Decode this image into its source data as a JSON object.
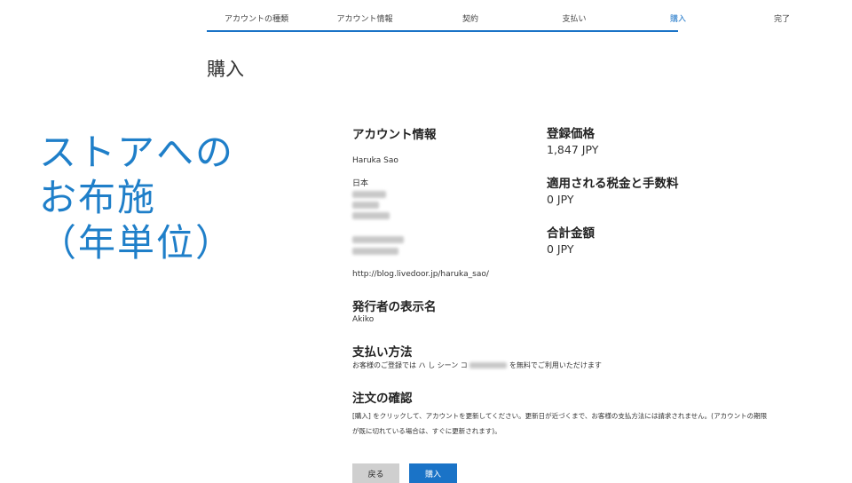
{
  "steps": [
    {
      "label": "アカウントの種類",
      "active": false
    },
    {
      "label": "アカウント情報",
      "active": false
    },
    {
      "label": "契約",
      "active": false
    },
    {
      "label": "支払い",
      "active": false
    },
    {
      "label": "購入",
      "active": true
    },
    {
      "label": "完了",
      "active": false
    }
  ],
  "page_title": "購入",
  "overlay": {
    "line1": "ストアへの",
    "line2": "お布施",
    "line3": "（年単位）",
    "color": "#1f7fc9"
  },
  "account": {
    "heading": "アカウント情報",
    "name": "Haruka Sao",
    "country": "日本",
    "url": "http://blog.livedoor.jp/haruka_sao/"
  },
  "publisher": {
    "heading": "発行者の表示名",
    "value": "Akiko"
  },
  "payment": {
    "heading": "支払い方法",
    "text_a": "お客様のご登録では ハ し シーン コ",
    "text_b": "を無料でご利用いただけます"
  },
  "confirm": {
    "heading": "注文の確認",
    "line1": "[購入] をクリックして、アカウントを更新してください。更新日が近づくまで、お客様の支払方法には請求されません。(アカウントの期限",
    "line2": "が既に切れている場合は、すぐに更新されます)。"
  },
  "pricing": {
    "registration_label": "登録価格",
    "registration_value": "1,847 JPY",
    "tax_label": "適用される税金と手数料",
    "tax_value": "0 JPY",
    "total_label": "合計金額",
    "total_value": "0 JPY"
  },
  "buttons": {
    "back": "戻る",
    "buy": "購入"
  },
  "colors": {
    "accent": "#1a73c7",
    "overlay": "#1f7fc9"
  }
}
